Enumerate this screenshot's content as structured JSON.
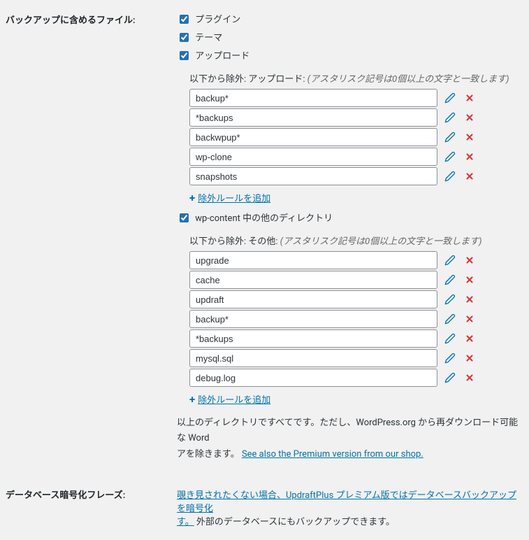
{
  "labels": {
    "files_to_include": "バックアップに含めるファイル:",
    "db_encrypt_phrase": "データベース暗号化フレーズ:"
  },
  "checkboxes": {
    "plugins": "プラグイン",
    "themes": "テーマ",
    "uploads": "アップロード",
    "wp_content_other": "wp-content 中の他のディレクトリ"
  },
  "exclude": {
    "uploads_title_prefix": "以下から除外: アップロード: ",
    "other_title_prefix": "以下から除外: その他: ",
    "hint": "(アスタリスク記号は0個以上の文字と一致します)",
    "add_rule": "除外ルールを追加",
    "uploads_rules": [
      "backup*",
      "*backups",
      "backwpup*",
      "wp-clone",
      "snapshots"
    ],
    "other_rules": [
      "upgrade",
      "cache",
      "updraft",
      "backup*",
      "*backups",
      "mysql.sql",
      "debug.log"
    ]
  },
  "descr": {
    "dir_all_prefix": "以上のディレクトリですべてです。ただし、WordPress.org から再ダウンロード可能な Word",
    "dir_all_suffix": "アを除きます。",
    "see_shop": "See also the Premium version from our shop.",
    "encrypt_link": "覗き見されたくない場合、UpdraftPlus プレミアム版ではデータベースバックアップを暗号化",
    "encrypt_suffix1": "す。",
    "encrypt_rest": " 外部のデータベースにもバックアップできます。"
  }
}
